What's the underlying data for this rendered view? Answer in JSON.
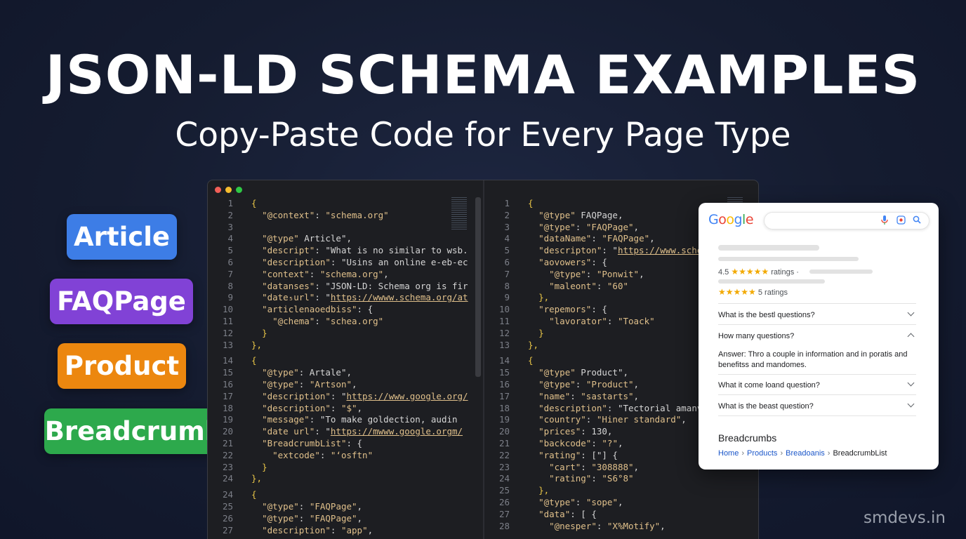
{
  "header": {
    "title": "JSON-LD SCHEMA EXAMPLES",
    "subtitle": "Copy-Paste Code for Every Page Type"
  },
  "pills": {
    "article": "Article",
    "faq": "FAQPage",
    "product": "Product",
    "breadcrumb": "BreadcrumbList"
  },
  "colors": {
    "background": "#151c30",
    "article": "#3d7de6",
    "faq": "#8142d6",
    "product": "#ec870f",
    "breadcrumb": "#2da94c",
    "code_string": "#e0c08b",
    "code_brace": "#e8c547"
  },
  "editor": {
    "left": [
      {
        "n": "1",
        "t": "{"
      },
      {
        "n": "2",
        "t": "  \"@context\": \"schema.org\""
      },
      {
        "n": "3",
        "t": ""
      },
      {
        "n": "4",
        "t": "  \"@type\" Article\","
      },
      {
        "n": "5",
        "t": "  \"descript\": \"What is no similar to wsb."
      },
      {
        "n": "6",
        "t": "  \"description\": \"Usins an online e-eb-ec"
      },
      {
        "n": "7",
        "t": "  \"context\": \"schema.org\","
      },
      {
        "n": "8",
        "t": "  \"datanses\": \"JSON-LD: Schema org is fir"
      },
      {
        "n": "9",
        "t": "  \"date₅url\": \"https://wwww.schema.org/at"
      },
      {
        "n": "10",
        "t": "  \"articlenaoedbiss\": {"
      },
      {
        "n": "11",
        "t": "    \"@chema\": \"schea.org\""
      },
      {
        "n": "12",
        "t": "  }"
      },
      {
        "n": "13",
        "t": "},"
      },
      {
        "n": "14",
        "t": "{"
      },
      {
        "n": "15",
        "t": "  \"@type\": Artale\","
      },
      {
        "n": "16",
        "t": "  \"@type\": \"Artson\","
      },
      {
        "n": "17",
        "t": "  \"description\": \"https://www.google.org/"
      },
      {
        "n": "18",
        "t": "  \"description\": \"$\","
      },
      {
        "n": "19",
        "t": "  \"message\": \"To make goldection, audin"
      },
      {
        "n": "20",
        "t": "  \"date url\": \"https://mwww.google.orgm/"
      },
      {
        "n": "21",
        "t": "  \"BreadcrumbList\": {"
      },
      {
        "n": "22",
        "t": "    \"extcode\": \"‘osftn\""
      },
      {
        "n": "23",
        "t": "  }"
      },
      {
        "n": "24",
        "t": "},"
      },
      {
        "n": "24",
        "t": "{"
      },
      {
        "n": "25",
        "t": "  \"@type\": \"FAQPage\","
      },
      {
        "n": "26",
        "t": "  \"@type\": \"FAQPage\","
      },
      {
        "n": "27",
        "t": "  \"description\": \"app\","
      }
    ],
    "right": [
      {
        "n": "1",
        "t": "{"
      },
      {
        "n": "2",
        "t": "  \"@type\" FAQPage,"
      },
      {
        "n": "3",
        "t": "  \"@type\": \"FAQPage\","
      },
      {
        "n": "4",
        "t": "  \"dataName\": \"FAQPage\","
      },
      {
        "n": "5",
        "t": "  \"descripton\": \"https://www.schema"
      },
      {
        "n": "6",
        "t": "  \"aovowers\": {"
      },
      {
        "n": "7",
        "t": "    \"@type\": \"Ponwit\","
      },
      {
        "n": "8",
        "t": "    \"maleont\": \"60\""
      },
      {
        "n": "9",
        "t": "  },"
      },
      {
        "n": "10",
        "t": "  \"repemors\": {"
      },
      {
        "n": "11",
        "t": "    \"lavorator\": \"Toack\""
      },
      {
        "n": "12",
        "t": "  }"
      },
      {
        "n": "13",
        "t": "},"
      },
      {
        "n": "14",
        "t": "{"
      },
      {
        "n": "15",
        "t": "  \"@type\" Product\","
      },
      {
        "n": "16",
        "t": "  \"@type\": \"Product\","
      },
      {
        "n": "17",
        "t": "  \"name\": \"sastarts\","
      },
      {
        "n": "18",
        "t": "  \"description\": \"Tectorial amanv"
      },
      {
        "n": "19",
        "t": "  \"country\": \"Hiner standard\","
      },
      {
        "n": "20",
        "t": "  \"prices\": 130,"
      },
      {
        "n": "21",
        "t": "  \"backcode\": \"?\","
      },
      {
        "n": "22",
        "t": "  \"rating\": [\"] {"
      },
      {
        "n": "23",
        "t": "    \"cart\": \"308888\","
      },
      {
        "n": "24",
        "t": "    \"rating\": \"S6°8\""
      },
      {
        "n": "25",
        "t": "  },"
      },
      {
        "n": "26",
        "t": "  \"@type\": \"sope\","
      },
      {
        "n": "27",
        "t": "  \"data\": [ {"
      },
      {
        "n": "28",
        "t": "    \"@nesper\": \"X%Motify\","
      }
    ]
  },
  "google": {
    "logo": [
      "G",
      "o",
      "o",
      "g",
      "l",
      "e"
    ],
    "icons": {
      "mic": "mic-icon",
      "lens": "lens-icon",
      "search": "search-icon"
    },
    "rating1_value": "4.5",
    "rating1_stars": "★★★★★",
    "rating1_label": "ratings ·",
    "rating2_stars": "★★★★★",
    "rating2_label": "5 ratings",
    "questions": [
      "What is the bestl questions?",
      "How many questions?",
      "What it come loand question?",
      "What is the beast question?"
    ],
    "answer": "Answer: Thro a couple in information and in poratis and benefitss and mandomes.",
    "breadcrumbs_title": "Breadcrumbs",
    "breadcrumbs": [
      "Home",
      "Products",
      "Breadoanis",
      "BreadcrumbList"
    ],
    "separator": "›"
  },
  "watermark": "smdevs.in"
}
